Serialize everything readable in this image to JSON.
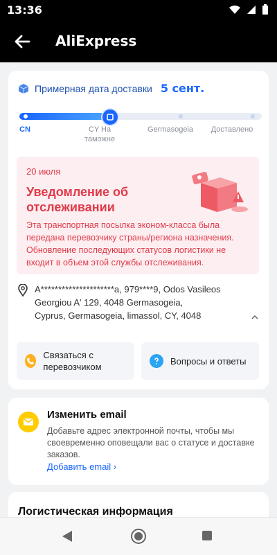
{
  "status_bar": {
    "time": "13:36",
    "icons": [
      "wifi-icon",
      "signal-icon",
      "battery-icon"
    ]
  },
  "app_bar": {
    "title": "AliExpress",
    "back_icon": "arrow-left-icon"
  },
  "delivery": {
    "estimate_label": "Примерная дата доставки",
    "estimate_date": "5 сент.",
    "stages": [
      {
        "label": "CN",
        "active": true
      },
      {
        "label": "CY На таможне",
        "active": true
      },
      {
        "label": "Germasogeia",
        "active": false
      },
      {
        "label": "Доставлено",
        "active": false
      }
    ],
    "progress_fraction": 0.36
  },
  "notice": {
    "date": "20 июля",
    "title": "Уведомление об отслеживании",
    "body": "Эта транспортная посылка эконом-класса была передана перевозчику страны/региона назначения. Обновление последующих статусов логистики не входит в объем этой службы отслеживания."
  },
  "address": {
    "line1": "A*********************a, 979****9, Odos Vasileos",
    "line2": "Georgiou A' 129, 4048 Germasogeia,",
    "line3": "Cyprus, Germasogeia, limassol, CY, 4048"
  },
  "actions": {
    "contact_carrier": "Связаться с перевозчиком",
    "faq": "Вопросы и ответы"
  },
  "email_card": {
    "title": "Изменить email",
    "description": "Добавьте адрес электронной почты, чтобы мы своевременно оповещали вас о статусе и доставке заказов.",
    "link": "Добавить email ›"
  },
  "logistics": {
    "title": "Логистическая информация"
  },
  "colors": {
    "accent": "#1a66ff",
    "notice_bg": "#fdeff1",
    "notice_text": "#e03a4a"
  }
}
